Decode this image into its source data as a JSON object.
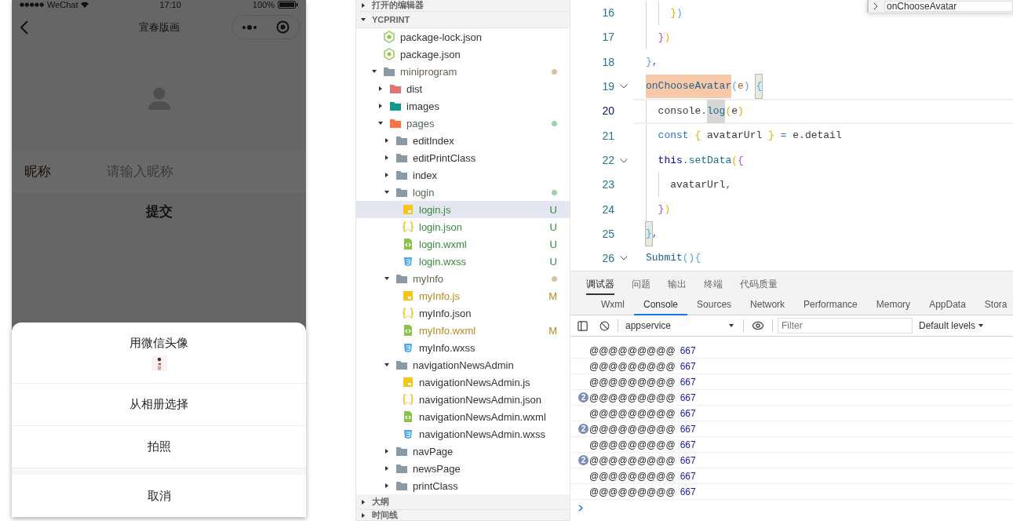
{
  "phone": {
    "status_bar": {
      "carrier": "WeChat",
      "time": "17:10",
      "battery": "100%"
    },
    "nav": {
      "title": "宜春版画"
    },
    "form": {
      "nickname_label": "昵称",
      "nickname_placeholder": "请输入昵称",
      "submit": "提交"
    },
    "action_sheet": {
      "items": [
        {
          "label": "用微信头像",
          "kind": "picture"
        },
        {
          "label": "从相册选择",
          "kind": "plain"
        },
        {
          "label": "拍照",
          "kind": "plain"
        }
      ],
      "cancel": "取消"
    }
  },
  "explorer": {
    "sections_top": [
      {
        "label": "打开的编辑器",
        "expanded": false
      },
      {
        "label": "YCPRINT",
        "expanded": true
      }
    ],
    "tree": [
      {
        "name": "package-lock.json",
        "kind": "npm"
      },
      {
        "name": "package.json",
        "kind": "npm"
      },
      {
        "name": "miniprogram",
        "kind": "folder",
        "expanded": true,
        "color": "#d3c3a3",
        "children": [
          {
            "name": "dist",
            "kind": "folder-red",
            "expanded": false
          },
          {
            "name": "images",
            "kind": "folder-teal",
            "expanded": false
          },
          {
            "name": "pages",
            "kind": "folder-orange",
            "expanded": true,
            "color": "#9fd0a6",
            "children": [
              {
                "name": "editIndex",
                "kind": "folder",
                "expanded": false
              },
              {
                "name": "editPrintClass",
                "kind": "folder",
                "expanded": false
              },
              {
                "name": "index",
                "kind": "folder",
                "expanded": false
              },
              {
                "name": "login",
                "kind": "folder",
                "expanded": true,
                "color": "#9fd0a6",
                "children": [
                  {
                    "name": "login.js",
                    "kind": "js",
                    "badge": "U",
                    "selected": true
                  },
                  {
                    "name": "login.json",
                    "kind": "json",
                    "badge": "U",
                    "selected": false
                  },
                  {
                    "name": "login.wxml",
                    "kind": "wxml",
                    "badge": "U",
                    "selected": false
                  },
                  {
                    "name": "login.wxss",
                    "kind": "wxss",
                    "badge": "U",
                    "selected": false
                  }
                ]
              },
              {
                "name": "myInfo",
                "kind": "folder",
                "expanded": true,
                "color": "#d3c3a3",
                "children": [
                  {
                    "name": "myInfo.js",
                    "kind": "js",
                    "badge": "M",
                    "selected": false
                  },
                  {
                    "name": "myInfo.json",
                    "kind": "json",
                    "selected": false
                  },
                  {
                    "name": "myInfo.wxml",
                    "kind": "wxml",
                    "badge": "M",
                    "selected": false
                  },
                  {
                    "name": "myInfo.wxss",
                    "kind": "wxss",
                    "selected": false
                  }
                ]
              },
              {
                "name": "navigationNewsAdmin",
                "kind": "folder",
                "expanded": true,
                "children": [
                  {
                    "name": "navigationNewsAdmin.js",
                    "kind": "js",
                    "selected": false
                  },
                  {
                    "name": "navigationNewsAdmin.json",
                    "kind": "json",
                    "selected": false
                  },
                  {
                    "name": "navigationNewsAdmin.wxml",
                    "kind": "wxml",
                    "selected": false
                  },
                  {
                    "name": "navigationNewsAdmin.wxss",
                    "kind": "wxss",
                    "selected": false
                  }
                ]
              },
              {
                "name": "navPage",
                "kind": "folder",
                "expanded": false
              },
              {
                "name": "newsPage",
                "kind": "folder",
                "expanded": false
              },
              {
                "name": "printClass",
                "kind": "folder",
                "expanded": false
              }
            ]
          }
        ]
      }
    ],
    "sections_bottom": [
      {
        "label": "大纲",
        "expanded": false
      },
      {
        "label": "时间线",
        "expanded": false
      }
    ]
  },
  "editor": {
    "find_widget": {
      "value": "onChooseAvatar"
    },
    "lines": [
      {
        "number": "16",
        "current": false,
        "foldable": false,
        "indented": true,
        "nested": true,
        "tokens": [
          {
            "t": "}",
            "kind": "bracket1"
          },
          {
            "t": ")",
            "kind": "bracket3"
          }
        ]
      },
      {
        "number": "17",
        "current": false,
        "foldable": false,
        "indented": true,
        "nested": false,
        "tokens": [
          {
            "t": "}",
            "kind": "bracket2"
          },
          {
            "t": ")",
            "kind": "bracket1"
          }
        ]
      },
      {
        "number": "18",
        "current": false,
        "foldable": false,
        "tokens": [
          {
            "t": "}",
            "kind": "bracket3"
          },
          {
            "t": ",",
            "kind": "punct"
          }
        ]
      },
      {
        "number": "19",
        "current": false,
        "foldable": true,
        "tokens": [
          {
            "t": "onChooseAvatar",
            "kind": "func",
            "search_match": true
          },
          {
            "t": "(",
            "kind": "bracket3"
          },
          {
            "t": "e",
            "kind": "param"
          },
          {
            "t": ") ",
            "kind": "bracket3"
          },
          {
            "t": "{",
            "kind": "bracket3",
            "bracket_match": true
          }
        ]
      },
      {
        "number": "20",
        "current": true,
        "foldable": false,
        "indented": true,
        "nested": false,
        "tokens": [
          {
            "t": "console",
            "kind": "text"
          },
          {
            "t": ".",
            "kind": "punct"
          },
          {
            "t": "log",
            "kind": "method",
            "word_match": true
          },
          {
            "t": "(",
            "kind": "bracket1"
          },
          {
            "t": "e",
            "kind": "text"
          },
          {
            "t": ")",
            "kind": "bracket1"
          }
        ]
      },
      {
        "number": "21",
        "current": false,
        "foldable": false,
        "indented": true,
        "nested": false,
        "tokens": [
          {
            "t": "const ",
            "kind": "keyword"
          },
          {
            "t": "{",
            "kind": "bracket1"
          },
          {
            "t": " avatarUrl ",
            "kind": "text"
          },
          {
            "t": "} ",
            "kind": "bracket1"
          },
          {
            "t": "= ",
            "kind": "keyword"
          },
          {
            "t": "e",
            "kind": "text"
          },
          {
            "t": ".",
            "kind": "punct"
          },
          {
            "t": "detail",
            "kind": "text"
          }
        ]
      },
      {
        "number": "22",
        "current": false,
        "foldable": true,
        "indented": true,
        "nested": false,
        "tokens": [
          {
            "t": "this",
            "kind": "this"
          },
          {
            "t": ".",
            "kind": "punct"
          },
          {
            "t": "setData",
            "kind": "method"
          },
          {
            "t": "(",
            "kind": "bracket1"
          },
          {
            "t": "{",
            "kind": "bracket2"
          }
        ]
      },
      {
        "number": "23",
        "current": false,
        "foldable": false,
        "indented": true,
        "nested": true,
        "tokens": [
          {
            "t": "avatarUrl",
            "kind": "text"
          },
          {
            "t": ",",
            "kind": "punct"
          }
        ]
      },
      {
        "number": "24",
        "current": false,
        "foldable": false,
        "indented": true,
        "nested": false,
        "tokens": [
          {
            "t": "}",
            "kind": "bracket2"
          },
          {
            "t": ")",
            "kind": "bracket1"
          }
        ]
      },
      {
        "number": "25",
        "current": false,
        "foldable": false,
        "tokens": [
          {
            "t": "}",
            "kind": "bracket3",
            "bracket_match": true
          },
          {
            "t": ",",
            "kind": "punct"
          }
        ]
      },
      {
        "number": "26",
        "current": false,
        "foldable": true,
        "tokens": [
          {
            "t": "Submit",
            "kind": "func"
          },
          {
            "t": "()",
            "kind": "bracket3"
          },
          {
            "t": "{",
            "kind": "bracket3"
          }
        ]
      }
    ]
  },
  "devtools": {
    "panel_tabs": [
      {
        "label": "调试器",
        "selected": true
      },
      {
        "label": "问题",
        "selected": false
      },
      {
        "label": "输出",
        "selected": false
      },
      {
        "label": "终端",
        "selected": false
      },
      {
        "label": "代码质量",
        "selected": false
      }
    ],
    "tool_tabs": [
      {
        "label": "Wxml",
        "selected": false
      },
      {
        "label": "Console",
        "selected": true
      },
      {
        "label": "Sources",
        "selected": false
      },
      {
        "label": "Network",
        "selected": false
      },
      {
        "label": "Performance",
        "selected": false
      },
      {
        "label": "Memory",
        "selected": false
      },
      {
        "label": "AppData",
        "selected": false
      },
      {
        "label": "Stora",
        "selected": false
      }
    ],
    "context": "appservice",
    "filter_placeholder": "Filter",
    "levels": "Default levels",
    "console_rows": [
      {
        "text": "@@@@@@@@@",
        "value": "667"
      },
      {
        "text": "@@@@@@@@@",
        "value": "667"
      },
      {
        "text": "@@@@@@@@@",
        "value": "667"
      },
      {
        "count": "2",
        "text": "@@@@@@@@@",
        "value": "667"
      },
      {
        "text": "@@@@@@@@@",
        "value": "667"
      },
      {
        "count": "2",
        "text": "@@@@@@@@@",
        "value": "667"
      },
      {
        "text": "@@@@@@@@@",
        "value": "667"
      },
      {
        "count": "2",
        "text": "@@@@@@@@@",
        "value": "667"
      },
      {
        "text": "@@@@@@@@@",
        "value": "667"
      },
      {
        "text": "@@@@@@@@@",
        "value": "667"
      }
    ]
  }
}
